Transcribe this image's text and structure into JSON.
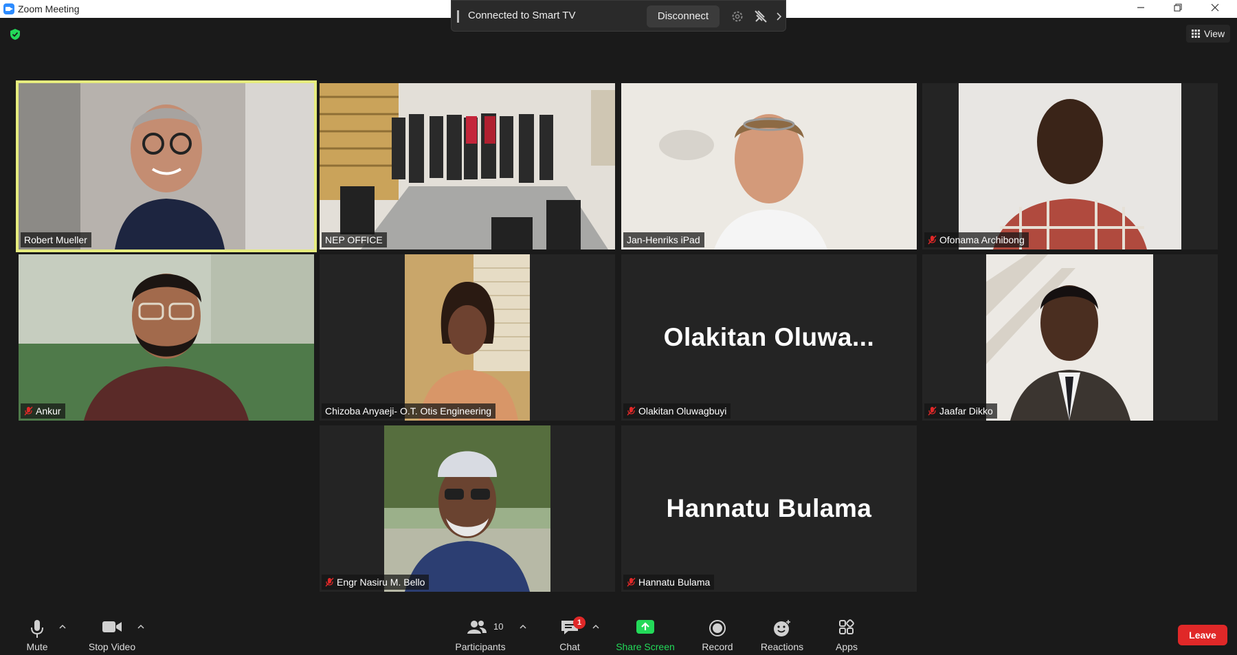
{
  "window": {
    "title": "Zoom Meeting",
    "minimize_icon": "minimize-icon",
    "maximize_icon": "restore-icon",
    "close_icon": "close-icon"
  },
  "smart_tv": {
    "status": "Connected to Smart TV",
    "disconnect_label": "Disconnect"
  },
  "view": {
    "label": "View"
  },
  "participants": [
    {
      "name": "Robert Mueller",
      "muted": false,
      "active_speaker": true,
      "video": true
    },
    {
      "name": "NEP OFFICE",
      "muted": false,
      "video": true
    },
    {
      "name": "Jan-Henriks iPad",
      "muted": false,
      "video": true
    },
    {
      "name": "Ofonama Archibong",
      "muted": true,
      "video": true
    },
    {
      "name": "Ankur",
      "muted": true,
      "video": true
    },
    {
      "name": "Chizoba Anyaeji- O.T. Otis Engineering",
      "muted": false,
      "video": true
    },
    {
      "name": "Olakitan Oluwagbuyi",
      "display_name": "Olakitan  Oluwa...",
      "muted": true,
      "video": false
    },
    {
      "name": "Jaafar Dikko",
      "muted": true,
      "video": true
    },
    {
      "name": "Engr Nasiru M. Bello",
      "muted": true,
      "video": true
    },
    {
      "name": "Hannatu Bulama",
      "display_name": "Hannatu Bulama",
      "muted": true,
      "video": false
    }
  ],
  "toolbar": {
    "mute_label": "Mute",
    "video_label": "Stop Video",
    "participants_label": "Participants",
    "participants_count": "10",
    "chat_label": "Chat",
    "chat_badge": "1",
    "share_label": "Share Screen",
    "record_label": "Record",
    "reactions_label": "Reactions",
    "apps_label": "Apps",
    "leave_label": "Leave"
  },
  "colors": {
    "active_speaker_border": "#e6ec7e",
    "share_green": "#23d959",
    "leave_red": "#e02828",
    "muted_red": "#e02828"
  }
}
